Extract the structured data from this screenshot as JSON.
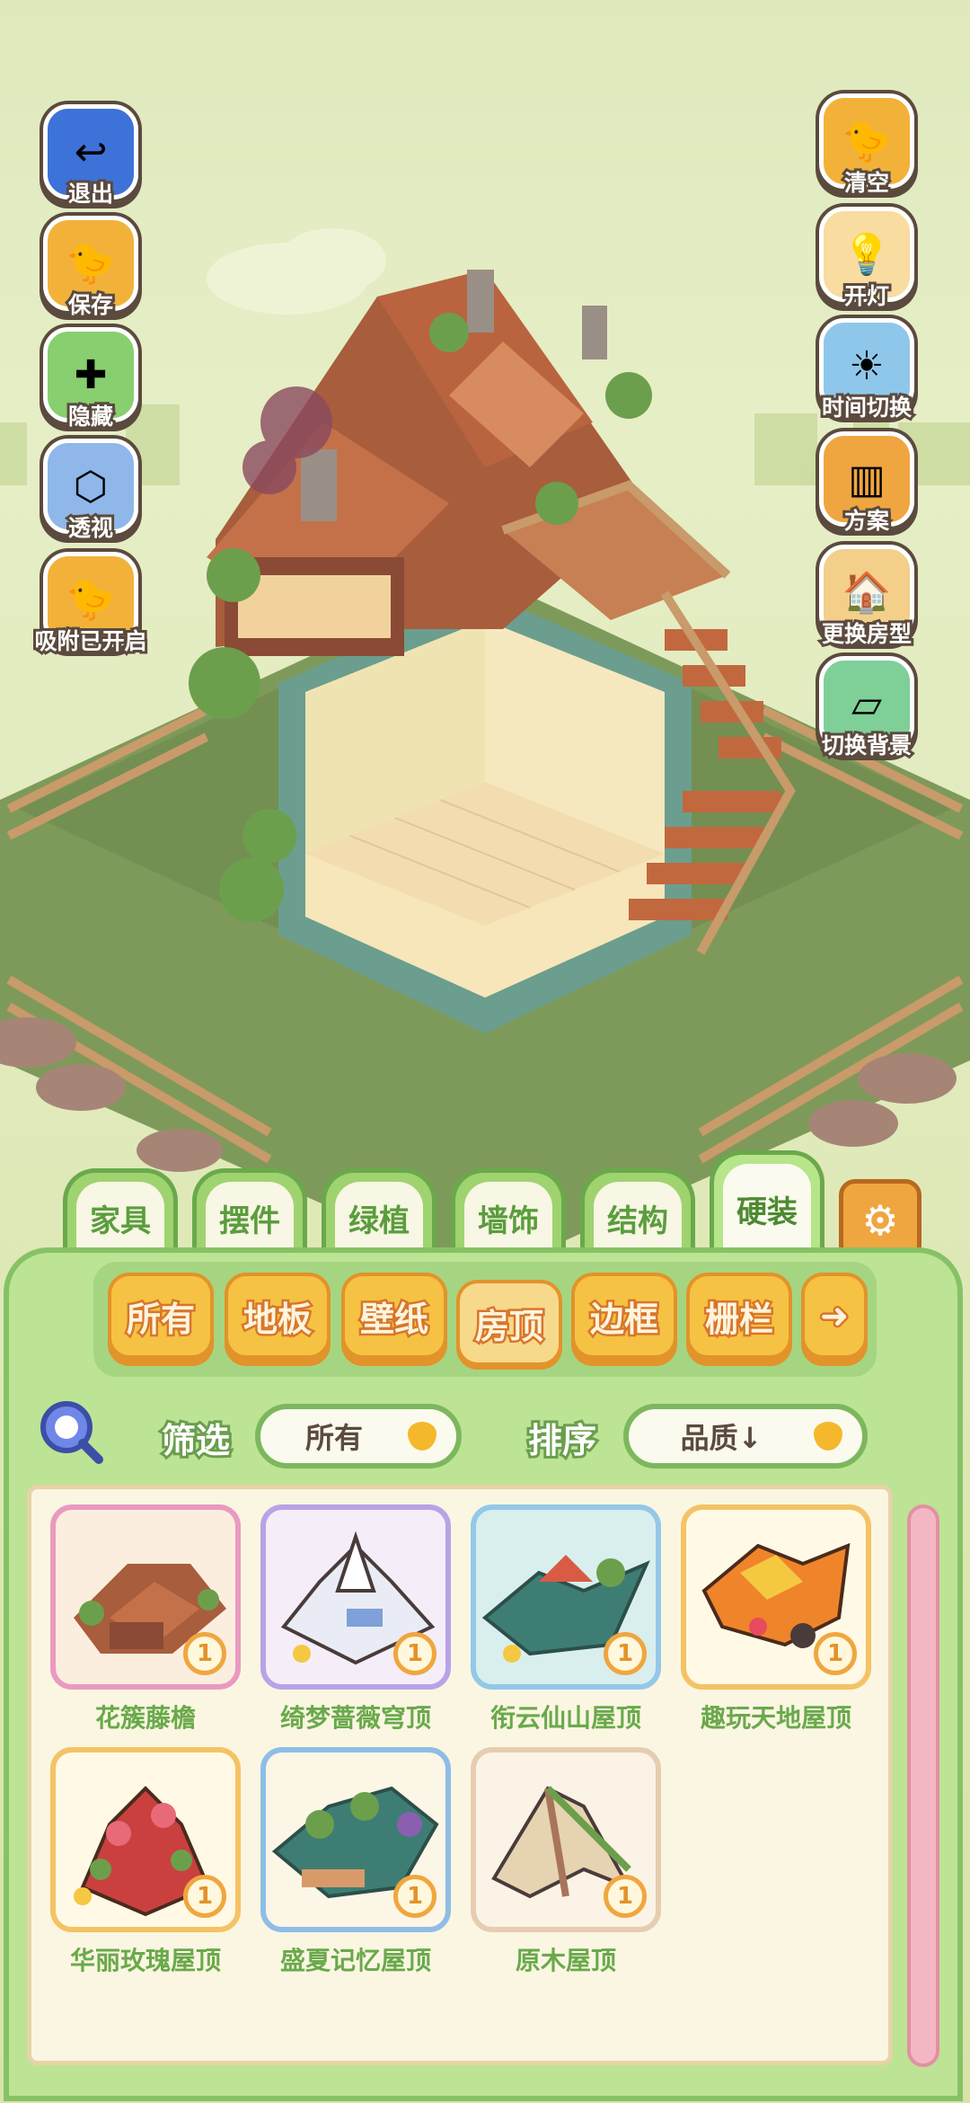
{
  "left_buttons": [
    {
      "label": "退出",
      "icon": "exit-icon"
    },
    {
      "label": "保存",
      "icon": "save-icon"
    },
    {
      "label": "隐藏",
      "icon": "hide-icon"
    },
    {
      "label": "透视",
      "icon": "perspective-icon"
    },
    {
      "label": "吸附已开启",
      "icon": "snap-icon"
    }
  ],
  "right_buttons": [
    {
      "label": "清空",
      "icon": "clear-icon"
    },
    {
      "label": "开灯",
      "icon": "light-icon"
    },
    {
      "label": "时间切换",
      "icon": "time-switch-icon"
    },
    {
      "label": "方案",
      "icon": "plan-icon"
    },
    {
      "label": "更换房型",
      "icon": "house-type-icon"
    },
    {
      "label": "切换背景",
      "icon": "background-icon"
    }
  ],
  "tabs": [
    "家具",
    "摆件",
    "绿植",
    "墙饰",
    "结构",
    "硬装"
  ],
  "active_tab": "硬装",
  "categories": [
    "所有",
    "地板",
    "壁纸",
    "房顶",
    "边框",
    "栅栏"
  ],
  "active_category": "房顶",
  "filter": {
    "label": "筛选",
    "value": "所有"
  },
  "sort": {
    "label": "排序",
    "value": "品质↓"
  },
  "items": [
    {
      "name": "花簇藤檐",
      "count": "1"
    },
    {
      "name": "绮梦蔷薇穹顶",
      "count": "1"
    },
    {
      "name": "衔云仙山屋顶",
      "count": "1"
    },
    {
      "name": "趣玩天地屋顶",
      "count": "1"
    },
    {
      "name": "华丽玫瑰屋顶",
      "count": "1"
    },
    {
      "name": "盛夏记忆屋顶",
      "count": "1"
    },
    {
      "name": "原木屋顶",
      "count": "1"
    }
  ],
  "colors": {
    "accent_green": "#6aa94b",
    "accent_orange": "#f0a640",
    "panel_green": "#bde394"
  }
}
